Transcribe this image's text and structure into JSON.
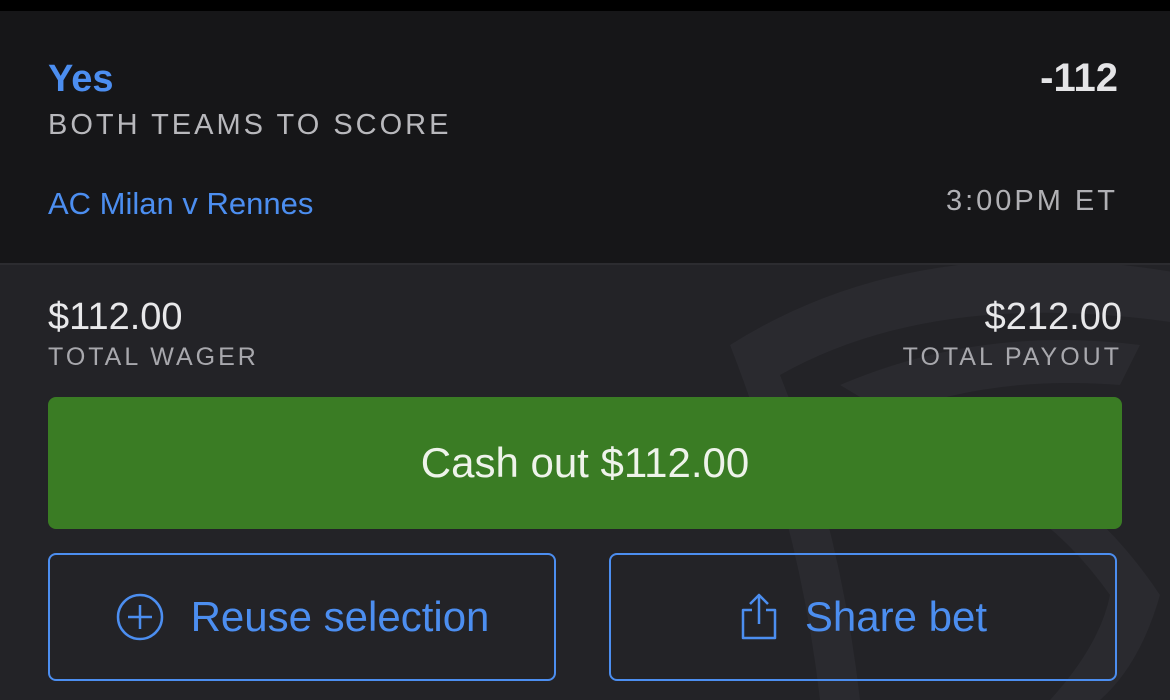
{
  "selection": {
    "name": "Yes",
    "market": "BOTH TEAMS TO SCORE",
    "odds": "-112",
    "event": "AC Milan v Rennes",
    "time": "3:00PM ET"
  },
  "summary": {
    "wager_amount": "$112.00",
    "wager_label": "TOTAL WAGER",
    "payout_amount": "$212.00",
    "payout_label": "TOTAL PAYOUT"
  },
  "actions": {
    "cashout_label": "Cash out $112.00",
    "reuse_label": "Reuse selection",
    "reuse_icon": "plus-circle-icon",
    "share_label": "Share bet",
    "share_icon": "share-icon"
  },
  "colors": {
    "accent_blue": "#4c8ef0",
    "cashout_green": "#3a7c24",
    "background": "#1f1f22"
  }
}
